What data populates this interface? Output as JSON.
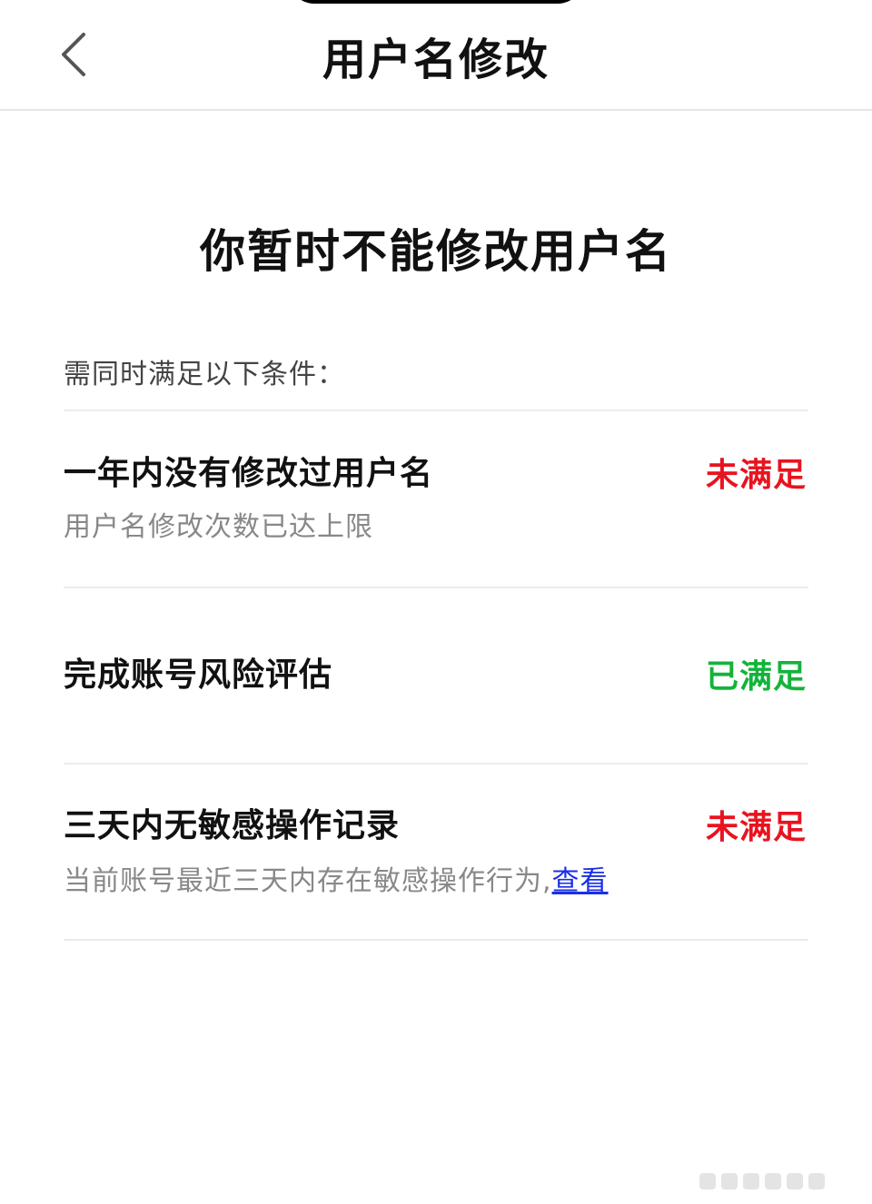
{
  "header": {
    "title": "用户名修改",
    "back_icon": "chevron-left-icon"
  },
  "main": {
    "headline": "你暂时不能修改用户名",
    "section_label": "需同时满足以下条件：",
    "conditions": [
      {
        "title": "一年内没有修改过用户名",
        "status": "未满足",
        "status_color": "#e8131f",
        "description": "用户名修改次数已达上限"
      },
      {
        "title": "完成账号风险评估",
        "status": "已满足",
        "status_color": "#13b33a"
      },
      {
        "title": "三天内无敏感操作记录",
        "status": "未满足",
        "status_color": "#e8131f",
        "description": "当前账号最近三天内存在敏感操作行为,",
        "link_label": "查看"
      }
    ]
  },
  "colors": {
    "unmet": "#e8131f",
    "met": "#13b33a",
    "link": "#1a2ee6"
  }
}
